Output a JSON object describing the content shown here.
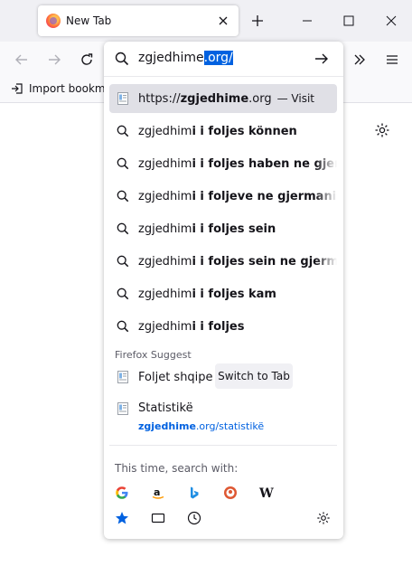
{
  "tab": {
    "title": "New Tab"
  },
  "bookmarks": {
    "import_label": "Import bookma"
  },
  "urlbar": {
    "typed": "zgjedhime",
    "autofill": ".org/"
  },
  "suggestions": {
    "first": {
      "prefix": "https://",
      "bold": "zgjedhime",
      "suffix": ".org",
      "visit": "— Visit"
    },
    "items": [
      {
        "typed": "zgjedhim",
        "rest": "i i foljes können"
      },
      {
        "typed": "zgjedhim",
        "rest": "i i foljes haben ne gjerm"
      },
      {
        "typed": "zgjedhim",
        "rest": "i i foljeve ne gjermanish"
      },
      {
        "typed": "zgjedhim",
        "rest": "i i foljes sein"
      },
      {
        "typed": "zgjedhim",
        "rest": "i i foljes sein ne gjerman"
      },
      {
        "typed": "zgjedhim",
        "rest": "i i foljes kam"
      },
      {
        "typed": "zgjedhim",
        "rest": "i i foljes"
      }
    ]
  },
  "firefox_suggest": {
    "label": "Firefox Suggest",
    "foljet": "Foljet shqipe",
    "switch_label": "Switch to Tab",
    "stat_title": "Statistikë",
    "stat_url_bold": "zgjedhime",
    "stat_url_rest": ".org/statistikë"
  },
  "footer": {
    "search_with": "This time, search with:"
  },
  "colors": {
    "accent": "#0061e0",
    "highlight": "#e0e0e6",
    "chrome": "#f0f0f4"
  }
}
